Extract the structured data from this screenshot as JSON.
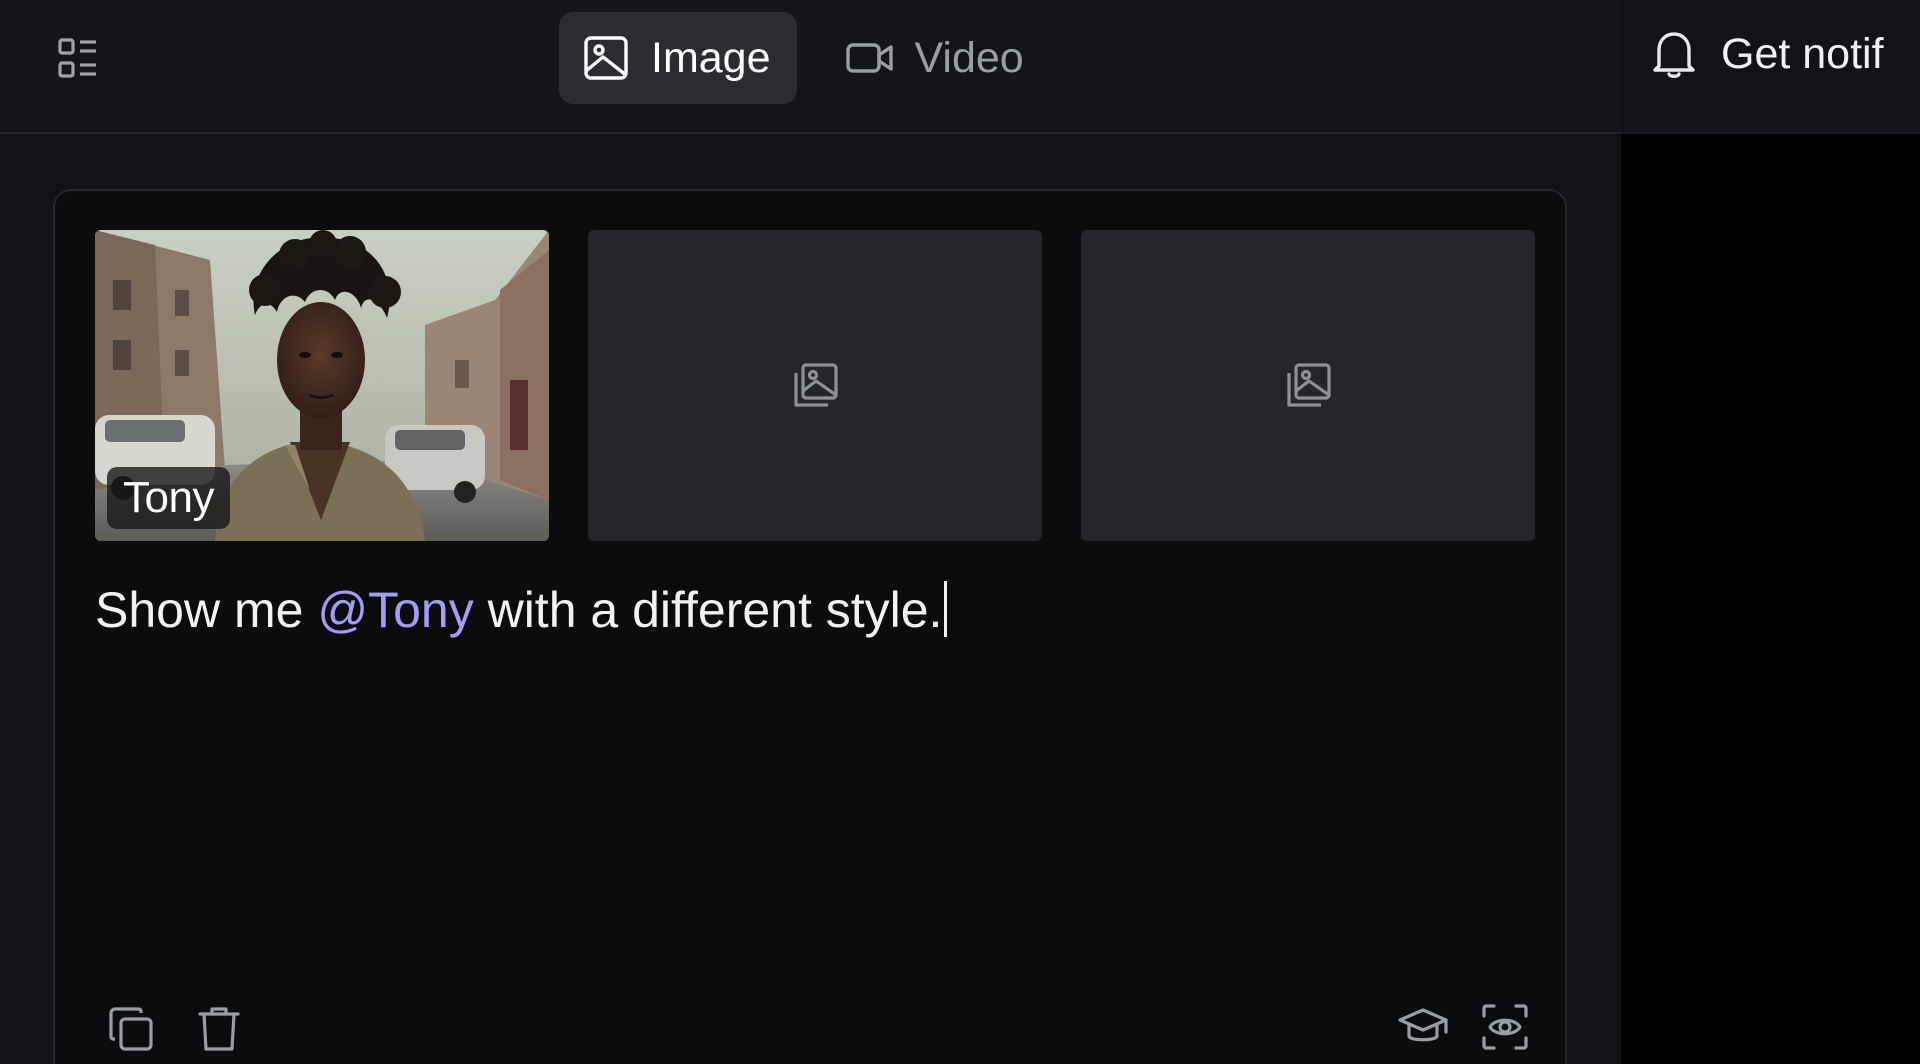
{
  "header": {
    "tabs": [
      {
        "label": "Image",
        "icon": "image-icon",
        "active": true
      },
      {
        "label": "Video",
        "icon": "video-camera-icon",
        "active": false
      }
    ],
    "notification_label": "Get notif"
  },
  "prompt_card": {
    "references": [
      {
        "label": "Tony",
        "has_image": true
      },
      {
        "label": "",
        "has_image": false,
        "icon": "add-image-icon"
      },
      {
        "label": "",
        "has_image": false,
        "icon": "add-image-icon"
      }
    ],
    "prompt": {
      "before": "Show me ",
      "mention": "@Tony",
      "after": " with a different style."
    },
    "tools_left": [
      "copy-icon",
      "trash-icon"
    ],
    "tools_right": [
      "graduation-cap-icon",
      "eye-scan-icon"
    ]
  },
  "colors": {
    "mention": "#a79cf5",
    "active_tab_bg": "#2b2c31"
  }
}
